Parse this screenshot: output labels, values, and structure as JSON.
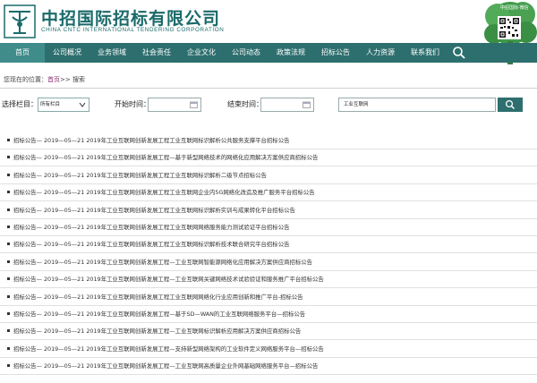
{
  "brand": {
    "name_cn": "中招国际招标有限公司",
    "name_en": "CHINA CNTC INTERNATIONAL TENDERING CORPORATION",
    "qr_label": "中招国际·微信",
    "accent": "#2d6f6e"
  },
  "nav": {
    "items": [
      {
        "label": "首页"
      },
      {
        "label": "公司概况"
      },
      {
        "label": "业务领域"
      },
      {
        "label": "社会责任"
      },
      {
        "label": "企业文化"
      },
      {
        "label": "公司动态"
      },
      {
        "label": "政策法规"
      },
      {
        "label": "招标公告"
      },
      {
        "label": "人力资源"
      },
      {
        "label": "联系我们"
      }
    ],
    "search_icon": "search-icon"
  },
  "breadcrumb": {
    "prefix": "您现在的位置：",
    "home": "首页",
    "sep": ">> ",
    "current": "搜索"
  },
  "filter": {
    "column_label": "选择栏目：",
    "column_value": "所有栏目",
    "start_label": "开始时间：",
    "end_label": "结束时间：",
    "keyword_value": "工业互联网"
  },
  "results": [
    {
      "text": "招标公告—  2019—05—21  2019年工业互联网创新发展工程工业互联网标识解析公共服务支撑平台招标公告"
    },
    {
      "text": "招标公告—  2019—05—21  2019年工业互联网创新发展工程—基于新型网络技术的网络化应用解决方案供应商招标公告"
    },
    {
      "text": "招标公告—  2019—05—21  2019年工业互联网创新发展工程工业互联网标识解析二级节点招标公告"
    },
    {
      "text": "招标公告—  2019—05—21  2019年工业互联网创新发展工程工业互联网企业内5G网络化改造及推广服务平台招标公告"
    },
    {
      "text": "招标公告—  2019—05—21  2019年工业互联网创新发展工程工业互联网标识解析实训与成果转化平台招标公告"
    },
    {
      "text": "招标公告—  2019—05—21  2019年工业互联网创新发展工程工业互联网网络服务能力测试验证平台招标公告"
    },
    {
      "text": "招标公告—  2019—05—21  2019年工业互联网创新发展工程工业互联网标识解析技术联合研究平台招标公告"
    },
    {
      "text": "招标公告—  2019—05—21  2019年工业互联网创新发展工程—工业互联网智能源网络化应用解决方案供应商招标公告"
    },
    {
      "text": "招标公告—  2019—05—21  2019年工业互联网创新发展工程—工业互联网关键网络技术试验验证和服务推广平台招标公告"
    },
    {
      "text": "招标公告—  2019—05—21  2019年工业互联网创新发展工程工业互联网网络化行业应用创新和推广平台-招标公告"
    },
    {
      "text": "招标公告—  2019—05—21  2019年工业互联网创新发展工程—基于SD—WAN的工业互联网络服务平台—招标公告"
    },
    {
      "text": "招标公告—  2019—05—21  2019年工业互联网创新发展工程—工业互联网标识解析应用解决方案供应商招标公告"
    },
    {
      "text": "招标公告—  2019—05—21  2019年工业互联网创新发展工程—支持新型网络架构的工业软件定义网络服务平台—招标公告"
    },
    {
      "text": "招标公告—  2019—05—21  2019年工业互联网创新发展工程—工业互联网高质量企业外网基础网络服务平台—招标公告"
    }
  ]
}
